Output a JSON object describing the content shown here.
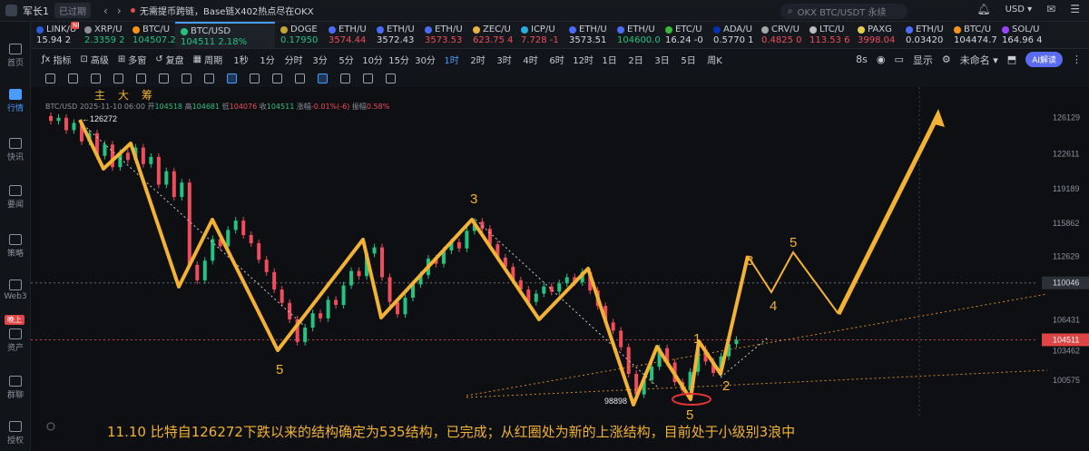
{
  "topbar": {
    "account": "军长1",
    "expired": "已过期",
    "news": "无需提币跨链，Base链X402热点尽在OKX",
    "search_placeholder": "OKX BTC/USDT 永续",
    "currency": "USD"
  },
  "sidebar": {
    "items": [
      "首页",
      "行情",
      "快讯",
      "要闻",
      "策略",
      "Web3",
      "资产",
      "群聊",
      "授权"
    ],
    "badge": "晚上"
  },
  "tickers": [
    {
      "sym": "LINK/U",
      "val": "15.94 2",
      "dir": "neu",
      "coin": "#2a5ada"
    },
    {
      "sym": "XRP/U",
      "val": "2.3359 2",
      "dir": "up",
      "coin": "#8a8f98"
    },
    {
      "sym": "BTC/U",
      "val": "104507.2",
      "dir": "up",
      "coin": "#f7931a"
    },
    {
      "sym": "BTC/USD",
      "val": "104511 2.18%",
      "dir": "up",
      "coin": "#26c281"
    },
    {
      "sym": "DOGE",
      "val": "0.17950",
      "dir": "up",
      "coin": "#c2a633"
    },
    {
      "sym": "ETH/U",
      "val": "3574.44",
      "dir": "down",
      "coin": "#4a6cf7"
    },
    {
      "sym": "ETH/U",
      "val": "3572.43",
      "dir": "neu",
      "coin": "#4a6cf7"
    },
    {
      "sym": "ETH/U",
      "val": "3573.53",
      "dir": "down",
      "coin": "#4a6cf7"
    },
    {
      "sym": "ZEC/U",
      "val": "623.75 4",
      "dir": "down",
      "coin": "#ecb244"
    },
    {
      "sym": "ICP/U",
      "val": "7.728 -1",
      "dir": "down",
      "coin": "#29abe2"
    },
    {
      "sym": "ETH/U",
      "val": "3573.51",
      "dir": "neu",
      "coin": "#4a6cf7"
    },
    {
      "sym": "ETH/U",
      "val": "104600.0",
      "dir": "up",
      "coin": "#4a6cf7"
    },
    {
      "sym": "ETC/U",
      "val": "16.24 -0",
      "dir": "neu",
      "coin": "#3ab83a"
    },
    {
      "sym": "ADA/U",
      "val": "0.5770 1",
      "dir": "neu",
      "coin": "#0033ad"
    },
    {
      "sym": "CRV/U",
      "val": "0.4825 0",
      "dir": "down",
      "coin": "#a5a5a5"
    },
    {
      "sym": "LTC/U",
      "val": "113.53 6",
      "dir": "down",
      "coin": "#bfbbbb"
    },
    {
      "sym": "PAXG",
      "val": "3998.04",
      "dir": "down",
      "coin": "#e4ce4d"
    },
    {
      "sym": "ETH/U",
      "val": "0.03420",
      "dir": "neu",
      "coin": "#4a6cf7"
    },
    {
      "sym": "BTC/U",
      "val": "104474.7",
      "dir": "neu",
      "coin": "#f7931a"
    },
    {
      "sym": "SOL/U",
      "val": "164.96 4",
      "dir": "neu",
      "coin": "#9945ff"
    }
  ],
  "new_badge": "NEW",
  "toolbar": {
    "indicators": "指标",
    "advanced": "高级",
    "multi": "多窗",
    "replay": "复盘",
    "period": "周期",
    "periods": [
      "1秒",
      "1分",
      "分时",
      "3分",
      "5分",
      "10分",
      "15分",
      "30分",
      "1时",
      "2时",
      "3时",
      "4时",
      "6时",
      "12时",
      "1日",
      "2日",
      "3日",
      "5日",
      "周K"
    ],
    "active_period": "1时",
    "speed": "8s",
    "display": "显示",
    "unnamed": "未命名",
    "ai": "AI解读"
  },
  "legend": {
    "main": "主",
    "big": "大",
    "chips": "筹"
  },
  "info": {
    "pair": "BTC/USD",
    "time": "2025-11-10 06:00",
    "open_label": "开",
    "open": "104518",
    "high_label": "高",
    "high": "104681",
    "low_label": "低",
    "low": "104076",
    "close_label": "收",
    "close": "104511",
    "change_label": "涨幅",
    "change": "-0.01%(-6)",
    "amp_label": "振幅",
    "amp": "0.58%"
  },
  "chart_data": {
    "type": "candlestick",
    "y_ticks": [
      126129,
      122611,
      119189,
      115862,
      112629,
      110046,
      106431,
      104511,
      103462,
      100575
    ],
    "ylim": [
      98200,
      128200
    ],
    "price_labels": {
      "current": "104511",
      "marked": "110046"
    },
    "annotations": {
      "high": "126272",
      "low": "98898"
    },
    "wave_labels": [
      "5",
      "3",
      "5",
      "1",
      "2",
      "3",
      "4",
      "5"
    ],
    "caption": "11.10 比特自126272下跌以来的结构确定为535结构，已完成；从红圈处为新的上涨结构，目前处于小级别3浪中",
    "candles": [
      [
        126272,
        125800
      ],
      [
        125800,
        126100
      ],
      [
        126100,
        124900
      ],
      [
        124900,
        125600
      ],
      [
        125600,
        123800
      ],
      [
        123800,
        124600
      ],
      [
        124600,
        122400
      ],
      [
        122400,
        123500
      ],
      [
        123500,
        121300
      ],
      [
        121300,
        122700
      ],
      [
        122700,
        122000
      ],
      [
        122000,
        123200
      ],
      [
        123200,
        121600
      ],
      [
        121600,
        122300
      ],
      [
        122300,
        119600
      ],
      [
        119600,
        120900
      ],
      [
        120900,
        118400
      ],
      [
        118400,
        119800
      ],
      [
        119800,
        111800
      ],
      [
        111800,
        110300
      ],
      [
        110300,
        112200
      ],
      [
        112200,
        114300
      ],
      [
        114300,
        113600
      ],
      [
        113600,
        115200
      ],
      [
        115200,
        116100
      ],
      [
        116100,
        114700
      ],
      [
        114700,
        113900
      ],
      [
        113900,
        112300
      ],
      [
        112300,
        111100
      ],
      [
        111100,
        109400
      ],
      [
        109400,
        108100
      ],
      [
        108100,
        106500
      ],
      [
        106500,
        104300
      ],
      [
        104300,
        105700
      ],
      [
        105700,
        107100
      ],
      [
        107100,
        106600
      ],
      [
        106600,
        108400
      ],
      [
        108400,
        107900
      ],
      [
        107900,
        109800
      ],
      [
        109800,
        111200
      ],
      [
        111200,
        110700
      ],
      [
        110700,
        112900
      ],
      [
        112900,
        113500
      ],
      [
        113500,
        110600
      ],
      [
        110600,
        108200
      ],
      [
        108200,
        107000
      ],
      [
        107000,
        108600
      ],
      [
        108600,
        109900
      ],
      [
        109900,
        110800
      ],
      [
        110800,
        112400
      ],
      [
        112400,
        111900
      ],
      [
        111900,
        113200
      ],
      [
        113200,
        114000
      ],
      [
        114000,
        113400
      ],
      [
        113400,
        115100
      ],
      [
        115100,
        116000
      ],
      [
        116000,
        115300
      ],
      [
        115300,
        113800
      ],
      [
        113800,
        112500
      ],
      [
        112500,
        111600
      ],
      [
        111600,
        110300
      ],
      [
        110300,
        109400
      ],
      [
        109400,
        108200
      ],
      [
        108200,
        109000
      ],
      [
        109000,
        109700
      ],
      [
        109700,
        109200
      ],
      [
        109200,
        110000
      ],
      [
        110000,
        110600
      ],
      [
        110600,
        110100
      ],
      [
        110100,
        111100
      ],
      [
        111100,
        109300
      ],
      [
        109300,
        107800
      ],
      [
        107800,
        106200
      ],
      [
        106200,
        105400
      ],
      [
        105400,
        103800
      ],
      [
        103800,
        101200
      ],
      [
        101200,
        99200
      ],
      [
        99200,
        100600
      ],
      [
        100600,
        101900
      ],
      [
        101900,
        103700
      ],
      [
        103700,
        102300
      ],
      [
        102300,
        100400
      ],
      [
        100400,
        99600
      ],
      [
        99600,
        101400
      ],
      [
        101400,
        103600
      ],
      [
        103600,
        102400
      ],
      [
        102400,
        101300
      ],
      [
        101300,
        102900
      ],
      [
        102900,
        104100
      ],
      [
        104100,
        104511
      ]
    ]
  }
}
